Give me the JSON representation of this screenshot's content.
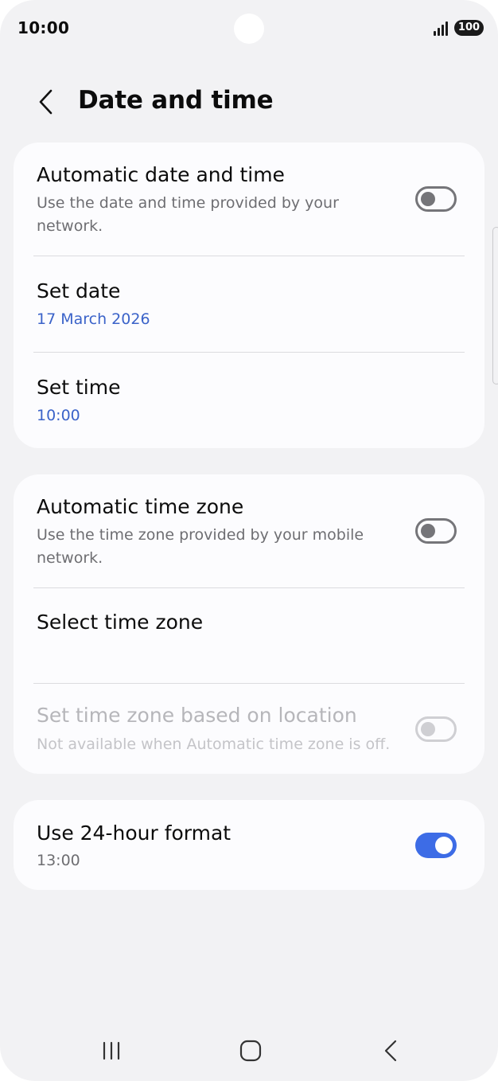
{
  "status_bar": {
    "time": "10:00",
    "battery": "100",
    "signal_icon": "signal-bars-icon",
    "camera_icon": "front-camera-cutout"
  },
  "header": {
    "title": "Date and time",
    "back_icon": "chevron-left-icon"
  },
  "card1": {
    "auto_date_time": {
      "title": "Automatic date and time",
      "subtitle": "Use the date and time provided by your network.",
      "enabled": false
    },
    "set_date": {
      "title": "Set date",
      "value": "17 March 2026"
    },
    "set_time": {
      "title": "Set time",
      "value": "10:00"
    }
  },
  "card2": {
    "auto_time_zone": {
      "title": "Automatic time zone",
      "subtitle": "Use the time zone provided by your mobile network.",
      "enabled": false
    },
    "select_time_zone": {
      "title": "Select time zone"
    },
    "location_time_zone": {
      "title": "Set time zone based on location",
      "subtitle": "Not available when Automatic time zone is off.",
      "enabled": false,
      "disabled": true
    }
  },
  "card3": {
    "use_24_hour": {
      "title": "Use 24-hour format",
      "subtitle": "13:00",
      "enabled": true
    }
  },
  "nav": {
    "recents_icon": "recents-icon",
    "home_icon": "home-icon",
    "back_icon": "back-icon"
  },
  "colors": {
    "accent": "#3d6ce6",
    "value_text": "#3b63c9",
    "background": "#f2f2f4",
    "card": "#fcfcfe"
  }
}
